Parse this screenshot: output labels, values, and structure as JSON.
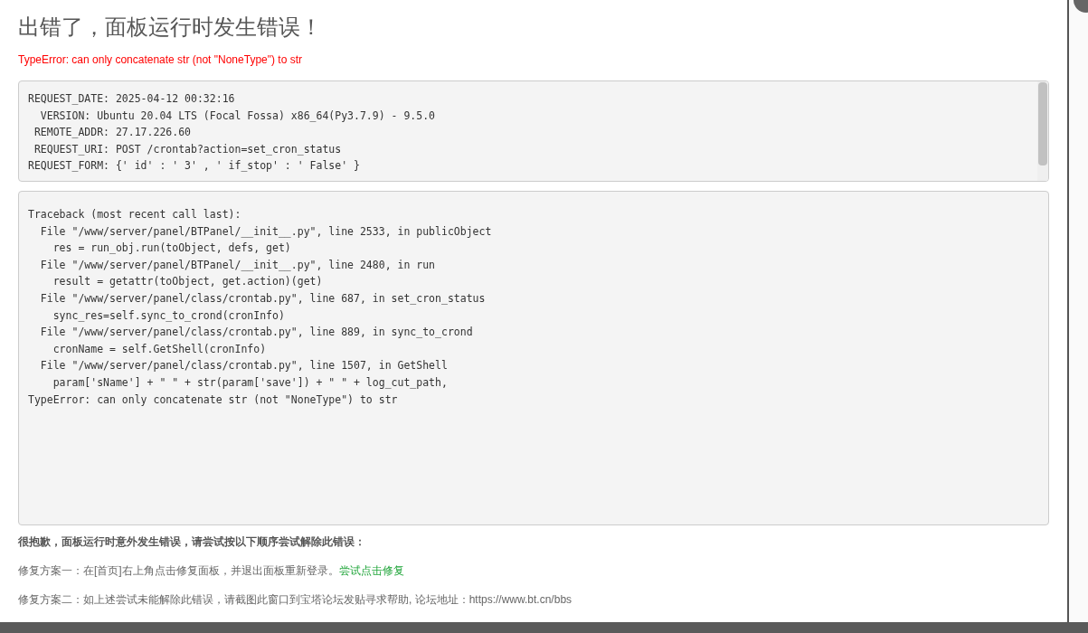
{
  "title": "出错了，面板运行时发生错误！",
  "error_message": "TypeError: can only concatenate str (not \"NoneType\") to str",
  "request_info": {
    "lines": [
      "REQUEST_DATE: 2025-04-12 00:32:16",
      "  VERSION: Ubuntu 20.04 LTS (Focal Fossa) x86_64(Py3.7.9) - 9.5.0",
      " REMOTE_ADDR: 27.17.226.60",
      " REQUEST_URI: POST /crontab?action=set_cron_status",
      "REQUEST_FORM: {' id' : ' 3' , ' if_stop' : ' False' }"
    ]
  },
  "traceback": {
    "lines": [
      "Traceback (most recent call last):",
      "  File \"/www/server/panel/BTPanel/__init__.py\", line 2533, in publicObject",
      "    res = run_obj.run(toObject, defs, get)",
      "  File \"/www/server/panel/BTPanel/__init__.py\", line 2480, in run",
      "    result = getattr(toObject, get.action)(get)",
      "  File \"/www/server/panel/class/crontab.py\", line 687, in set_cron_status",
      "    sync_res=self.sync_to_crond(cronInfo)",
      "  File \"/www/server/panel/class/crontab.py\", line 889, in sync_to_crond",
      "    cronName = self.GetShell(cronInfo)",
      "  File \"/www/server/panel/class/crontab.py\", line 1507, in GetShell",
      "    param['sName'] + \" \" + str(param['save']) + \" \" + log_cut_path,",
      "TypeError: can only concatenate str (not \"NoneType\") to str"
    ]
  },
  "apology": "很抱歉，面板运行时意外发生错误，请尝试按以下顺序尝试解除此错误：",
  "fixes": [
    {
      "text": "修复方案一：在[首页]右上角点击修复面板，并退出面板重新登录。",
      "link": "尝试点击修复"
    },
    {
      "text": "修复方案二：如上述尝试未能解除此错误，请截图此窗口到宝塔论坛发贴寻求帮助, 论坛地址：https://www.bt.cn/bbs"
    }
  ]
}
